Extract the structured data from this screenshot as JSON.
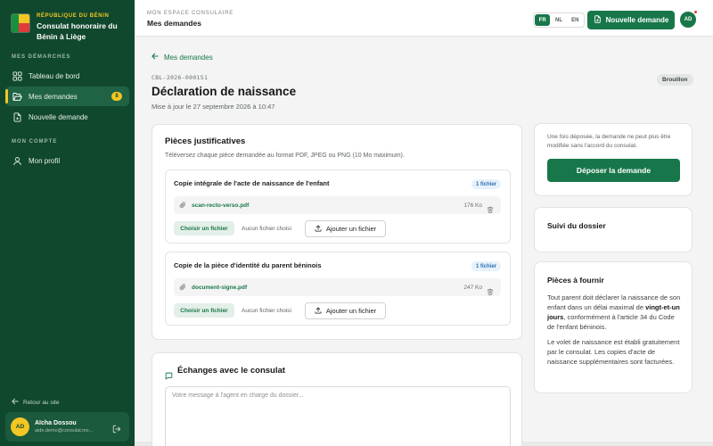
{
  "sidebar": {
    "country": "RÉPUBLIQUE DU BÉNIN",
    "title": "Consulat honoraire du Bénin à Liège",
    "section_procedures": "MES DÉMARCHES",
    "items": [
      {
        "label": "Tableau de bord"
      },
      {
        "label": "Mes demandes",
        "badge": "8"
      },
      {
        "label": "Nouvelle demande"
      }
    ],
    "section_account": "MON COMPTE",
    "profile_label": "Mon profil",
    "back_to_site": "Retour au site",
    "user": {
      "initials": "AD",
      "name": "Aïcha Dossou",
      "email": "aide.demo@consulat.ino..."
    }
  },
  "topbar": {
    "space_label": "MON ESPACE CONSULAIRE",
    "page_label": "Mes demandes",
    "languages": [
      "FR",
      "NL",
      "EN"
    ],
    "active_language": "FR",
    "new_request_label": "Nouvelle demande",
    "avatar_initials": "AD"
  },
  "request": {
    "back_label": "Mes demandes",
    "reference": "CBL-2026-000151",
    "title": "Déclaration de naissance",
    "updated": "Mise à jour le 27 septembre 2026 à 10:47",
    "status": "Brouillon"
  },
  "documents": {
    "title": "Pièces justificatives",
    "subtitle": "Téléversez chaque pièce demandée au format PDF, JPEG ou PNG (10 Mo maximum).",
    "groups": [
      {
        "title": "Copie intégrale de l'acte de naissance de l'enfant",
        "count": "1 fichier",
        "file_name": "scan-recto-verso.pdf",
        "file_size": "176 Ko",
        "choose_label": "Choisir un fichier",
        "no_file_label": "Aucun fichier choisi",
        "add_label": "Ajouter un fichier"
      },
      {
        "title": "Copie de la pièce d'identité du parent béninois",
        "count": "1 fichier",
        "file_name": "document-signe.pdf",
        "file_size": "247 Ko",
        "choose_label": "Choisir un fichier",
        "no_file_label": "Aucun fichier choisi",
        "add_label": "Ajouter un fichier"
      }
    ]
  },
  "exchanges": {
    "title": "Échanges avec le consulat",
    "placeholder": "Votre message à l'agent en charge du dossier..."
  },
  "submit_card": {
    "note": "Une fois déposée, la demande ne peut plus être modifiée sans l'accord du consulat.",
    "button_label": "Déposer la demande"
  },
  "tracking": {
    "title": "Suivi du dossier"
  },
  "requirements": {
    "title": "Pièces à fournir",
    "p1_before": "Tout parent doit déclarer la naissance de son enfant dans un délai maximal de ",
    "p1_strong": "vingt-et-un jours",
    "p1_after": ", conformément à l'article 34 du Code de l'enfant béninois.",
    "p2": "Le volet de naissance est établi gratuitement par le consulat. Les copies d'acte de naissance supplémentaires sont facturées."
  },
  "colors": {
    "sidebar_bg": "#10482d",
    "accent_green": "#18774a",
    "accent_yellow": "#f3c623",
    "notification_red": "#e23b3b"
  },
  "icons": [
    "grid-icon",
    "folder-open-icon",
    "new-document-icon",
    "user-icon",
    "arrow-left-icon",
    "logout-icon",
    "paperclip-icon",
    "trash-icon",
    "upload-icon",
    "chat-icon"
  ]
}
